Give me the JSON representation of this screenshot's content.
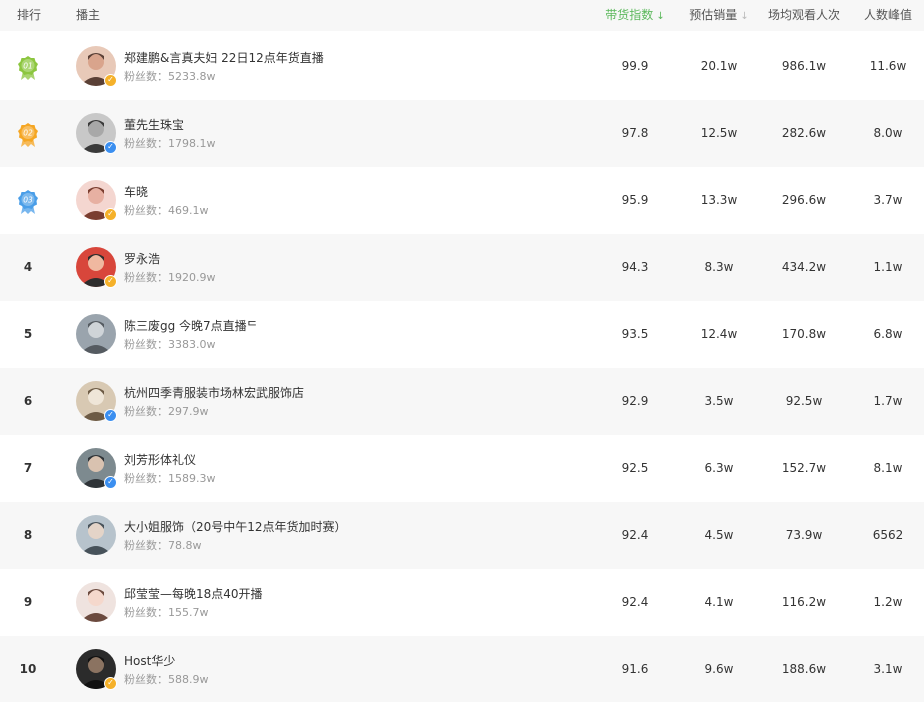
{
  "header": {
    "rank": "排行",
    "host": "播主",
    "col_index": "带货指数",
    "col_sales": "预估销量",
    "col_viewers": "场均观看人次",
    "col_peak": "人数峰值"
  },
  "colors": {
    "accent": "#5cb85c",
    "rank1": "#8cc63f",
    "rank2": "#f5a623",
    "rank3": "#4a9ee8",
    "verify_gold": "#f5b12a",
    "verify_blue": "#3b8ff0"
  },
  "rows": [
    {
      "rank": "",
      "medal_label": "01",
      "name": "郑建鹏&言真夫妇 22日12点年货直播",
      "fans": "粉丝数：5233.8w",
      "index": "99.9",
      "sales": "20.1w",
      "viewers": "986.1w",
      "peak": "11.6w",
      "verify": "gold"
    },
    {
      "rank": "",
      "medal_label": "02",
      "name": "董先生珠宝",
      "fans": "粉丝数：1798.1w",
      "index": "97.8",
      "sales": "12.5w",
      "viewers": "282.6w",
      "peak": "8.0w",
      "verify": "blue"
    },
    {
      "rank": "",
      "medal_label": "03",
      "name": "车晓",
      "fans": "粉丝数：469.1w",
      "index": "95.9",
      "sales": "13.3w",
      "viewers": "296.6w",
      "peak": "3.7w",
      "verify": "gold"
    },
    {
      "rank": "4",
      "name": "罗永浩",
      "fans": "粉丝数：1920.9w",
      "index": "94.3",
      "sales": "8.3w",
      "viewers": "434.2w",
      "peak": "1.1w",
      "verify": "gold"
    },
    {
      "rank": "5",
      "name": "陈三废gg 今晚7点直播ᄃ",
      "fans": "粉丝数：3383.0w",
      "index": "93.5",
      "sales": "12.4w",
      "viewers": "170.8w",
      "peak": "6.8w",
      "verify": "none"
    },
    {
      "rank": "6",
      "name": "杭州四季青服装市场林宏武服饰店",
      "fans": "粉丝数：297.9w",
      "index": "92.9",
      "sales": "3.5w",
      "viewers": "92.5w",
      "peak": "1.7w",
      "verify": "blue"
    },
    {
      "rank": "7",
      "name": "刘芳形体礼仪",
      "fans": "粉丝数：1589.3w",
      "index": "92.5",
      "sales": "6.3w",
      "viewers": "152.7w",
      "peak": "8.1w",
      "verify": "blue"
    },
    {
      "rank": "8",
      "name": "大小姐服饰（20号中午12点年货加时赛）",
      "fans": "粉丝数：78.8w",
      "index": "92.4",
      "sales": "4.5w",
      "viewers": "73.9w",
      "peak": "6562",
      "verify": "none"
    },
    {
      "rank": "9",
      "name": "邱莹莹—每晚18点40开播",
      "fans": "粉丝数：155.7w",
      "index": "92.4",
      "sales": "4.1w",
      "viewers": "116.2w",
      "peak": "1.2w",
      "verify": "none"
    },
    {
      "rank": "10",
      "name": "Host华少",
      "fans": "粉丝数：588.9w",
      "index": "91.6",
      "sales": "9.6w",
      "viewers": "188.6w",
      "peak": "3.1w",
      "verify": "gold"
    }
  ]
}
